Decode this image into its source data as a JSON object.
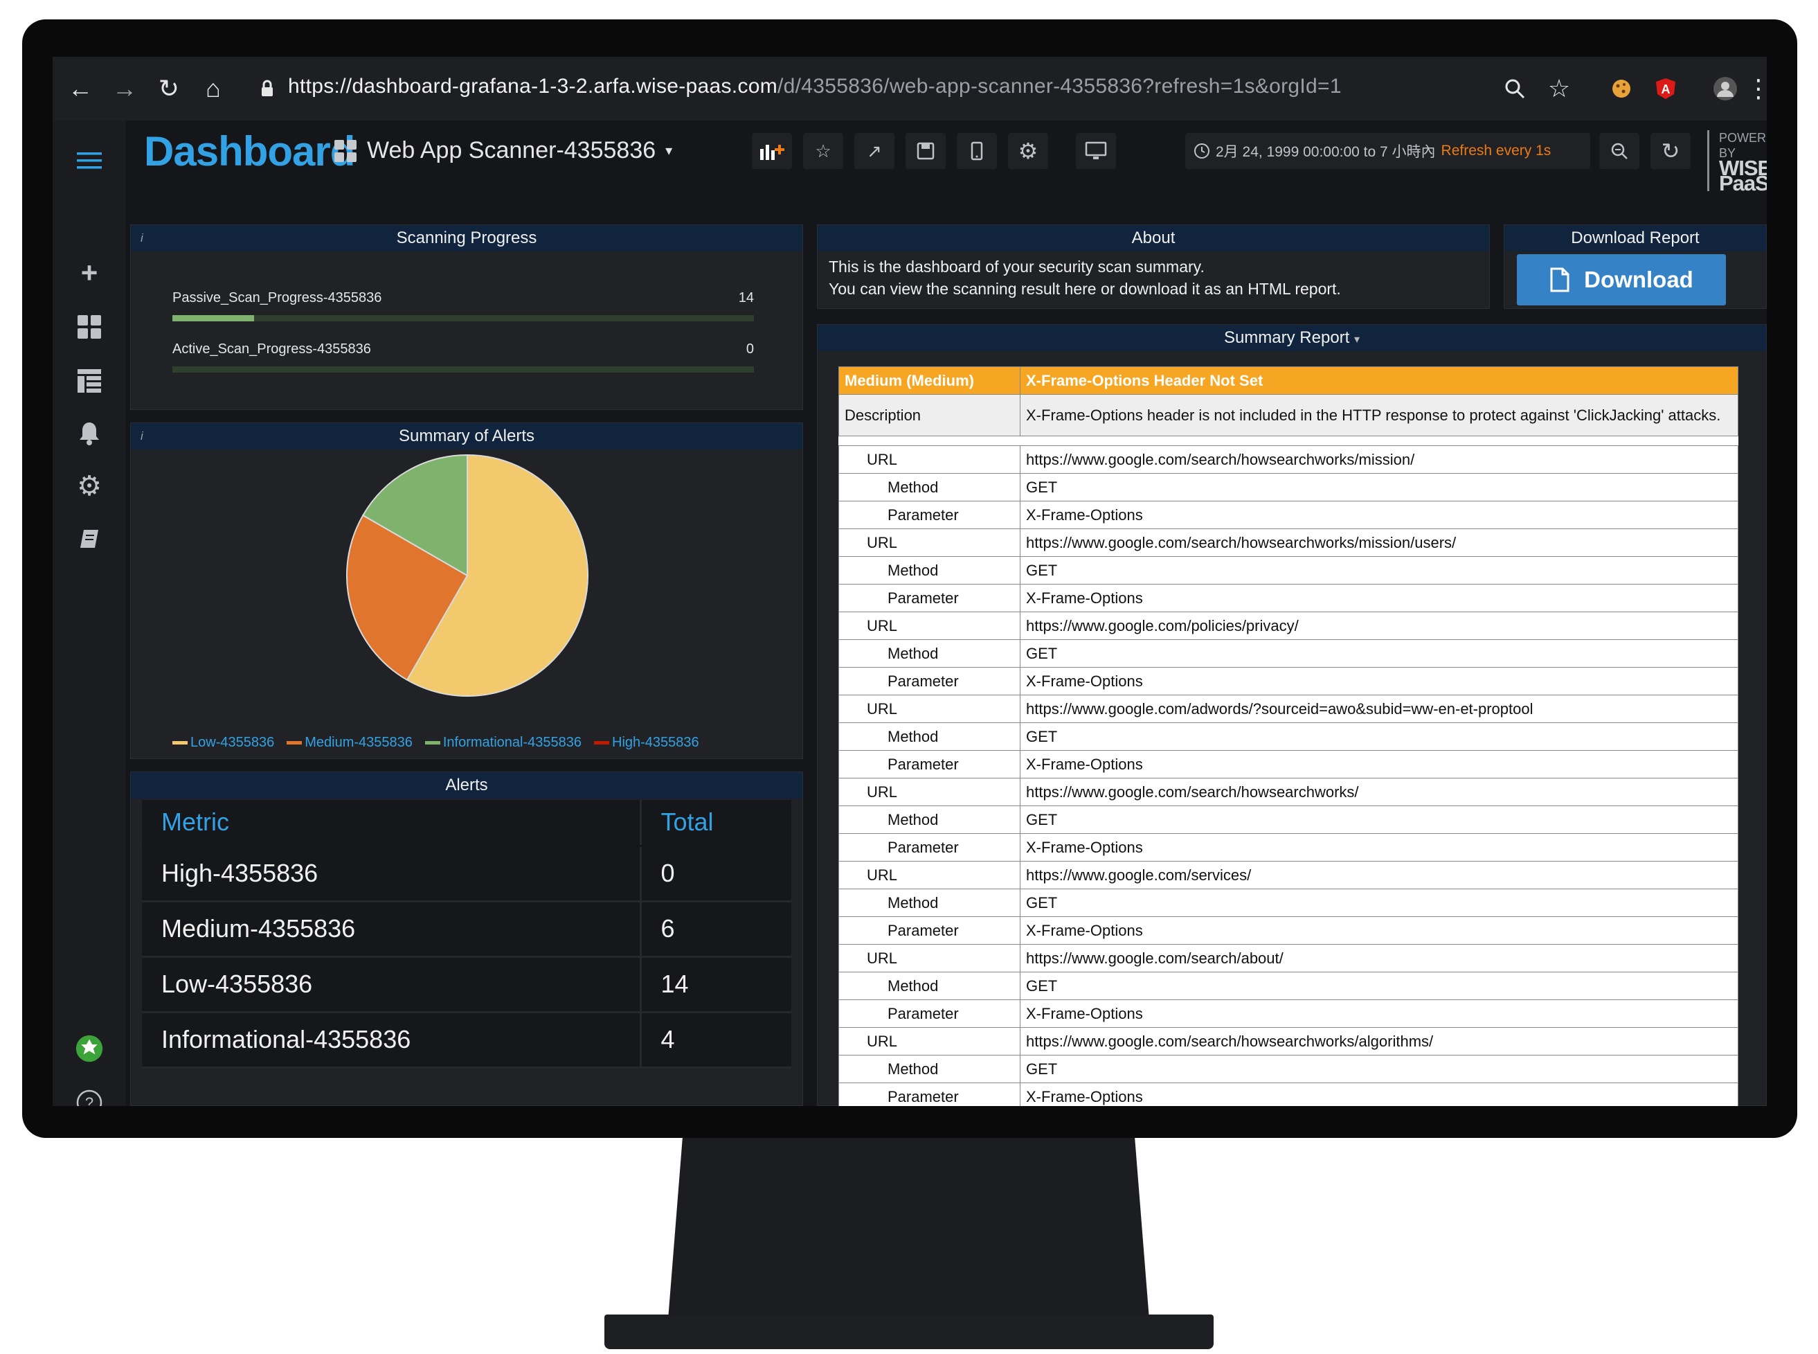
{
  "browser": {
    "url_host": "https://dashboard-grafana-1-3-2.arfa.wise-paas.com",
    "url_path": "/d/4355836/web-app-scanner-4355836?refresh=1s&orgId=1"
  },
  "nav": {
    "brand": "Dashboard",
    "dashboard_title": "Web App Scanner-4355836",
    "time_range": "2月 24, 1999 00:00:00 to 7 小時內",
    "refresh": "Refresh every 1s",
    "powered_by": "POWERED BY",
    "powered_brand": "WISE-PaaS"
  },
  "scanning_progress": {
    "title": "Scanning Progress",
    "rows": [
      {
        "label": "Passive_Scan_Progress-4355836",
        "value": "14",
        "fraction": 0.14
      },
      {
        "label": "Active_Scan_Progress-4355836",
        "value": "0",
        "fraction": 0
      }
    ]
  },
  "summary_alerts": {
    "title": "Summary of Alerts",
    "legend": [
      {
        "label": "Low-4355836",
        "color": "#f2c96d"
      },
      {
        "label": "Medium-4355836",
        "color": "#e0752d"
      },
      {
        "label": "Informational-4355836",
        "color": "#7eb26d"
      },
      {
        "label": "High-4355836",
        "color": "#bf1b00"
      }
    ]
  },
  "chart_data": {
    "type": "pie",
    "categories": [
      "Low-4355836",
      "Medium-4355836",
      "Informational-4355836",
      "High-4355836"
    ],
    "values": [
      14,
      6,
      4,
      0
    ],
    "colors": [
      "#f2c96d",
      "#e0752d",
      "#7eb26d",
      "#bf1b00"
    ],
    "legend": "bottom"
  },
  "alerts": {
    "title": "Alerts",
    "headers": [
      "Metric",
      "Total"
    ],
    "rows": [
      [
        "High-4355836",
        "0"
      ],
      [
        "Medium-4355836",
        "6"
      ],
      [
        "Low-4355836",
        "14"
      ],
      [
        "Informational-4355836",
        "4"
      ]
    ]
  },
  "about": {
    "title": "About",
    "line1": "This is the dashboard of your security scan summary.",
    "line2": "You can view the scanning result here or download it as an HTML report."
  },
  "download": {
    "title": "Download Report",
    "button": "Download"
  },
  "summary_report": {
    "title": "Summary Report",
    "risk": "Medium (Medium)",
    "alert": "X-Frame-Options Header Not Set",
    "desc_label": "Description",
    "description": "X-Frame-Options header is not included in the HTTP response to protect against 'ClickJacking' attacks.",
    "entries": [
      {
        "url": "https://www.google.com/search/howsearchworks/mission/",
        "method": "GET",
        "param": "X-Frame-Options"
      },
      {
        "url": "https://www.google.com/search/howsearchworks/mission/users/",
        "method": "GET",
        "param": "X-Frame-Options"
      },
      {
        "url": "https://www.google.com/policies/privacy/",
        "method": "GET",
        "param": "X-Frame-Options"
      },
      {
        "url": "https://www.google.com/adwords/?sourceid=awo&subid=ww-en-et-proptool",
        "method": "GET",
        "param": "X-Frame-Options"
      },
      {
        "url": "https://www.google.com/search/howsearchworks/",
        "method": "GET",
        "param": "X-Frame-Options"
      },
      {
        "url": "https://www.google.com/services/",
        "method": "GET",
        "param": "X-Frame-Options"
      },
      {
        "url": "https://www.google.com/search/about/",
        "method": "GET",
        "param": "X-Frame-Options"
      },
      {
        "url": "https://www.google.com/search/howsearchworks/algorithms/",
        "method": "GET",
        "param": "X-Frame-Options"
      }
    ],
    "labels": {
      "url": "URL",
      "method": "Method",
      "param": "Parameter"
    }
  }
}
